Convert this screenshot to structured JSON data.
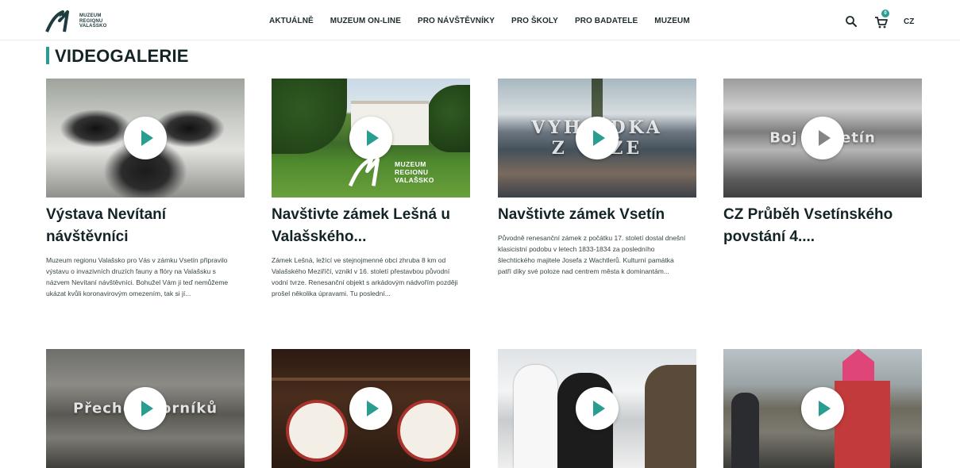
{
  "header": {
    "logo_lines": [
      "MUZEUM",
      "REGIONU",
      "VALAŠSKO"
    ],
    "nav": [
      "AKTUÁLNĚ",
      "MUZEUM ON-LINE",
      "PRO NÁVŠTĚVNÍKY",
      "PRO ŠKOLY",
      "PRO BADATELE",
      "MUZEUM"
    ],
    "cart_count": "0",
    "language": "CZ"
  },
  "page": {
    "title": "VIDEOGALERIE"
  },
  "videos": [
    {
      "title": "Výstava Nevítaní návštěvníci",
      "description": "Muzeum regionu Valašsko pro Vás v zámku Vsetín připravilo výstavu o invazivních druzích fauny a flóry na Valašsku s názvem Nevítaní návštěvníci. Bohužel Vám ji teď nemůžeme ukázat kvůli koronavirovým omezením, tak si jí...",
      "overlay": ""
    },
    {
      "title": "Navštivte zámek Lešná u Valašského...",
      "description": "Zámek Lešná, ležící ve stejnojmenné obci zhruba 8 km od Valašského Meziříčí, vznikl v 16. století přestavbou původní vodní tvrze. Renesanční objekt s arkádovým nádvořím později prošel několika úpravami. Tu poslední...",
      "overlay": "",
      "mark_lines": [
        "MUZEUM",
        "REGIONU",
        "VALAŠSKO"
      ]
    },
    {
      "title": "Navštivte zámek Vsetín",
      "description": "Původně renesanční zámek z počátku 17. století dostal dnešní klasicistní podobu v letech 1833-1834 za posledního šlechtického majitele Josefa z Wachtlerů. Kulturní památka patří díky své poloze nad centrem města k dominantám...",
      "overlay_1": "VYHLÍDKA",
      "overlay_2": "Z VĚŽE"
    },
    {
      "title": "CZ Průběh Vsetínského povstání 4....",
      "description": "",
      "overlay": "Boj o Vsetín"
    },
    {
      "title": "",
      "description": "",
      "overlay": "Přechod horníků"
    },
    {
      "title": "",
      "description": "",
      "overlay": ""
    },
    {
      "title": "",
      "description": "",
      "overlay": ""
    },
    {
      "title": "",
      "description": "",
      "overlay": ""
    }
  ],
  "colors": {
    "accent": "#2a9d91",
    "title": "#142426"
  }
}
